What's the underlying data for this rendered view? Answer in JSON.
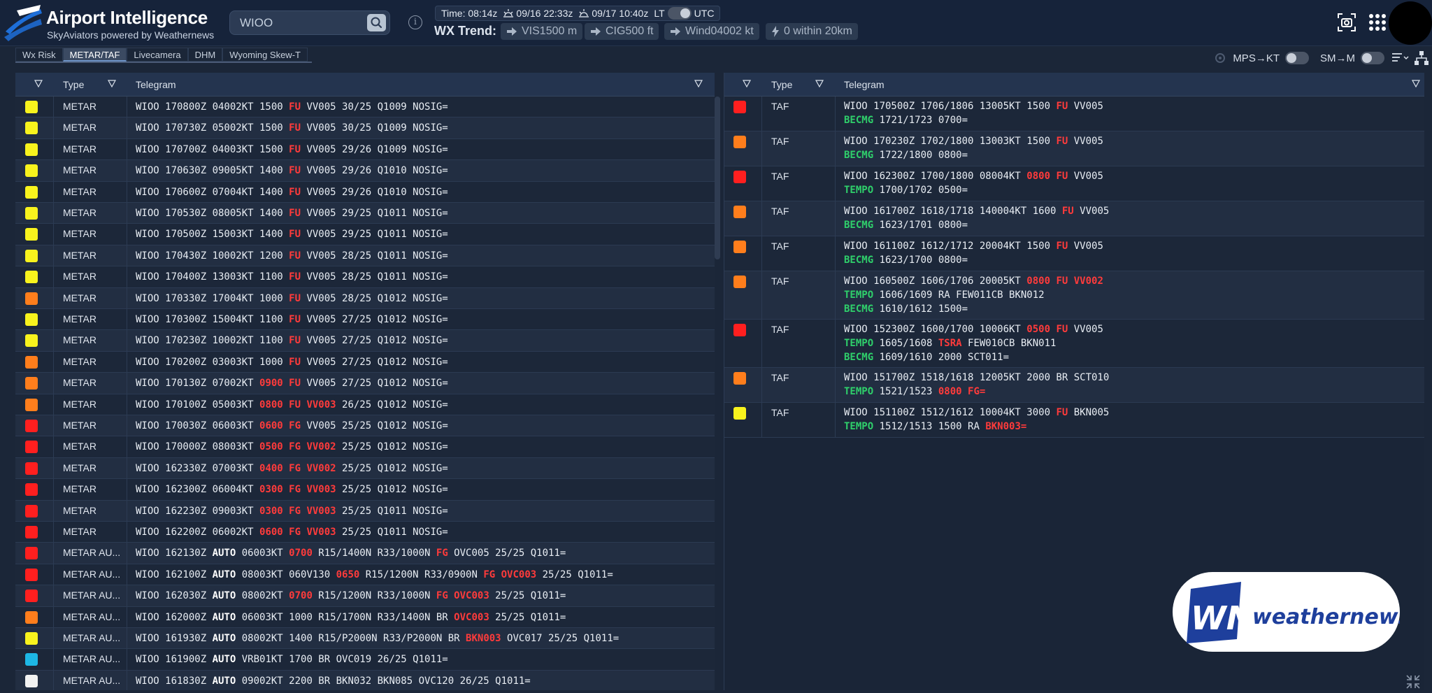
{
  "app": {
    "title": "Airport Intelligence",
    "subtitle": "SkyAviators powered by Weathernews",
    "brand_color": "#1e6fd9"
  },
  "search": {
    "value": "WIOO",
    "placeholder": "WIOO"
  },
  "timebar": {
    "time": "Time: 08:14z",
    "sunrise": "09/16 22:33z",
    "sunset": "09/17 10:40z",
    "lt_label": "LT",
    "utc_label": "UTC"
  },
  "wx_trend": {
    "label": "WX Trend:",
    "chips": [
      {
        "icon": "arrow-right-icon",
        "text": "VIS1500 m"
      },
      {
        "icon": "arrow-right-icon",
        "text": "CIG500 ft"
      },
      {
        "icon": "arrow-right-icon",
        "text": "Wind04002 kt"
      },
      {
        "icon": "lightning-icon",
        "text": "0 within 20km"
      }
    ]
  },
  "tabs": [
    "Wx Risk",
    "METAR/TAF",
    "Livecamera",
    "DHM",
    "Wyoming Skew-T"
  ],
  "active_tab": "METAR/TAF",
  "toggles": {
    "mps_kt": "MPS→KT",
    "sm_m": "SM→M"
  },
  "columns": {
    "type": "Type",
    "telegram": "Telegram"
  },
  "status_colors": {
    "yellow": "#f8f31d",
    "orange": "#ff7e1c",
    "red": "#ff1f1f",
    "cyan": "#1db7e5",
    "white": "#f2f2f2"
  },
  "metar_rows": [
    {
      "color": "yellow",
      "type": "METAR",
      "parts": [
        [
          "WIOO 170800Z 04002KT 1500 ",
          ""
        ],
        [
          "FU",
          "red"
        ],
        [
          " VV005 30/25 Q1009 NOSIG=",
          ""
        ]
      ]
    },
    {
      "color": "yellow",
      "type": "METAR",
      "parts": [
        [
          "WIOO 170730Z 05002KT 1500 ",
          ""
        ],
        [
          "FU",
          "red"
        ],
        [
          " VV005 30/25 Q1009 NOSIG=",
          ""
        ]
      ]
    },
    {
      "color": "yellow",
      "type": "METAR",
      "parts": [
        [
          "WIOO 170700Z 04003KT 1500 ",
          ""
        ],
        [
          "FU",
          "red"
        ],
        [
          " VV005 29/26 Q1009 NOSIG=",
          ""
        ]
      ]
    },
    {
      "color": "yellow",
      "type": "METAR",
      "parts": [
        [
          "WIOO 170630Z 09005KT 1400 ",
          ""
        ],
        [
          "FU",
          "red"
        ],
        [
          " VV005 29/26 Q1010 NOSIG=",
          ""
        ]
      ]
    },
    {
      "color": "yellow",
      "type": "METAR",
      "parts": [
        [
          "WIOO 170600Z 07004KT 1400 ",
          ""
        ],
        [
          "FU",
          "red"
        ],
        [
          " VV005 29/26 Q1010 NOSIG=",
          ""
        ]
      ]
    },
    {
      "color": "yellow",
      "type": "METAR",
      "parts": [
        [
          "WIOO 170530Z 08005KT 1400 ",
          ""
        ],
        [
          "FU",
          "red"
        ],
        [
          " VV005 29/25 Q1011 NOSIG=",
          ""
        ]
      ]
    },
    {
      "color": "yellow",
      "type": "METAR",
      "parts": [
        [
          "WIOO 170500Z 15003KT 1400 ",
          ""
        ],
        [
          "FU",
          "red"
        ],
        [
          " VV005 29/25 Q1011 NOSIG=",
          ""
        ]
      ]
    },
    {
      "color": "yellow",
      "type": "METAR",
      "parts": [
        [
          "WIOO 170430Z 10002KT 1200 ",
          ""
        ],
        [
          "FU",
          "red"
        ],
        [
          " VV005 28/25 Q1011 NOSIG=",
          ""
        ]
      ]
    },
    {
      "color": "yellow",
      "type": "METAR",
      "parts": [
        [
          "WIOO 170400Z 13003KT 1100 ",
          ""
        ],
        [
          "FU",
          "red"
        ],
        [
          " VV005 28/25 Q1011 NOSIG=",
          ""
        ]
      ]
    },
    {
      "color": "orange",
      "type": "METAR",
      "parts": [
        [
          "WIOO 170330Z 17004KT 1000 ",
          ""
        ],
        [
          "FU",
          "red"
        ],
        [
          " VV005 28/25 Q1012 NOSIG=",
          ""
        ]
      ]
    },
    {
      "color": "yellow",
      "type": "METAR",
      "parts": [
        [
          "WIOO 170300Z 15004KT 1100 ",
          ""
        ],
        [
          "FU",
          "red"
        ],
        [
          " VV005 27/25 Q1012 NOSIG=",
          ""
        ]
      ]
    },
    {
      "color": "yellow",
      "type": "METAR",
      "parts": [
        [
          "WIOO 170230Z 10002KT 1100 ",
          ""
        ],
        [
          "FU",
          "red"
        ],
        [
          " VV005 27/25 Q1012 NOSIG=",
          ""
        ]
      ]
    },
    {
      "color": "orange",
      "type": "METAR",
      "parts": [
        [
          "WIOO 170200Z 03003KT 1000 ",
          ""
        ],
        [
          "FU",
          "red"
        ],
        [
          " VV005 27/25 Q1012 NOSIG=",
          ""
        ]
      ]
    },
    {
      "color": "orange",
      "type": "METAR",
      "parts": [
        [
          "WIOO 170130Z 07002KT ",
          ""
        ],
        [
          "0900 FU",
          "red"
        ],
        [
          " VV005 27/25 Q1012 NOSIG=",
          ""
        ]
      ]
    },
    {
      "color": "orange",
      "type": "METAR",
      "parts": [
        [
          "WIOO 170100Z 05003KT ",
          ""
        ],
        [
          "0800 FU VV003",
          "red"
        ],
        [
          " 26/25 Q1012 NOSIG=",
          ""
        ]
      ]
    },
    {
      "color": "red",
      "type": "METAR",
      "parts": [
        [
          "WIOO 170030Z 06003KT ",
          ""
        ],
        [
          "0600 FG",
          "red"
        ],
        [
          " VV005 25/25 Q1012 NOSIG=",
          ""
        ]
      ]
    },
    {
      "color": "red",
      "type": "METAR",
      "parts": [
        [
          "WIOO 170000Z 08003KT ",
          ""
        ],
        [
          "0500 FG VV002",
          "red"
        ],
        [
          " 25/25 Q1012 NOSIG=",
          ""
        ]
      ]
    },
    {
      "color": "red",
      "type": "METAR",
      "parts": [
        [
          "WIOO 162330Z 07003KT ",
          ""
        ],
        [
          "0400 FG VV002",
          "red"
        ],
        [
          " 25/25 Q1012 NOSIG=",
          ""
        ]
      ]
    },
    {
      "color": "red",
      "type": "METAR",
      "parts": [
        [
          "WIOO 162300Z 06004KT ",
          ""
        ],
        [
          "0300 FG VV003",
          "red"
        ],
        [
          " 25/25 Q1012 NOSIG=",
          ""
        ]
      ]
    },
    {
      "color": "red",
      "type": "METAR",
      "parts": [
        [
          "WIOO 162230Z 09003KT ",
          ""
        ],
        [
          "0300 FG VV003",
          "red"
        ],
        [
          " 25/25 Q1011 NOSIG=",
          ""
        ]
      ]
    },
    {
      "color": "red",
      "type": "METAR",
      "parts": [
        [
          "WIOO 162200Z 06002KT ",
          ""
        ],
        [
          "0600 FG VV003",
          "red"
        ],
        [
          " 25/25 Q1011 NOSIG=",
          ""
        ]
      ]
    },
    {
      "color": "red",
      "type": "METAR AU...",
      "parts": [
        [
          "WIOO 162130Z ",
          ""
        ],
        [
          "AUTO",
          "bold"
        ],
        [
          " 06003KT ",
          ""
        ],
        [
          "0700",
          "red"
        ],
        [
          " R15/1400N R33/1000N ",
          ""
        ],
        [
          "FG",
          "red"
        ],
        [
          " OVC005 25/25 Q1011=",
          ""
        ]
      ]
    },
    {
      "color": "red",
      "type": "METAR AU...",
      "parts": [
        [
          "WIOO 162100Z ",
          ""
        ],
        [
          "AUTO",
          "bold"
        ],
        [
          " 08003KT 060V130 ",
          ""
        ],
        [
          "0650",
          "red"
        ],
        [
          " R15/1200N R33/0900N ",
          ""
        ],
        [
          "FG OVC003",
          "red"
        ],
        [
          " 25/25 Q1011=",
          ""
        ]
      ]
    },
    {
      "color": "red",
      "type": "METAR AU...",
      "parts": [
        [
          "WIOO 162030Z ",
          ""
        ],
        [
          "AUTO",
          "bold"
        ],
        [
          " 08002KT ",
          ""
        ],
        [
          "0700",
          "red"
        ],
        [
          " R15/1200N R33/1000N ",
          ""
        ],
        [
          "FG OVC003",
          "red"
        ],
        [
          " 25/25 Q1011=",
          ""
        ]
      ]
    },
    {
      "color": "orange",
      "type": "METAR AU...",
      "parts": [
        [
          "WIOO 162000Z ",
          ""
        ],
        [
          "AUTO",
          "bold"
        ],
        [
          " 06003KT 1000 R15/1700N R33/1400N BR ",
          ""
        ],
        [
          "OVC003",
          "red"
        ],
        [
          " 25/25 Q1011=",
          ""
        ]
      ]
    },
    {
      "color": "yellow",
      "type": "METAR AU...",
      "parts": [
        [
          "WIOO 161930Z ",
          ""
        ],
        [
          "AUTO",
          "bold"
        ],
        [
          " 08002KT 1400 R15/P2000N R33/P2000N BR ",
          ""
        ],
        [
          "BKN003",
          "red"
        ],
        [
          " OVC017 25/25 Q1011=",
          ""
        ]
      ]
    },
    {
      "color": "cyan",
      "type": "METAR AU...",
      "parts": [
        [
          "WIOO 161900Z ",
          ""
        ],
        [
          "AUTO",
          "bold"
        ],
        [
          " VRB01KT 1700 BR OVC019 26/25 Q1011=",
          ""
        ]
      ]
    },
    {
      "color": "white",
      "type": "METAR AU...",
      "parts": [
        [
          "WIOO 161830Z ",
          ""
        ],
        [
          "AUTO",
          "bold"
        ],
        [
          " 09002KT 2200 BR BKN032 BKN085 OVC120 26/25 Q1011=",
          ""
        ]
      ]
    }
  ],
  "taf_rows": [
    {
      "color": "red",
      "type": "TAF",
      "lines": [
        [
          [
            "WIOO 170500Z 1706/1806 13005KT 1500 ",
            ""
          ],
          [
            "FU",
            "red"
          ],
          [
            " VV005",
            ""
          ]
        ],
        [
          [
            "BECMG",
            "green"
          ],
          [
            " 1721/1723 0700=",
            ""
          ]
        ]
      ]
    },
    {
      "color": "orange",
      "type": "TAF",
      "lines": [
        [
          [
            "WIOO 170230Z 1702/1800 13003KT 1500 ",
            ""
          ],
          [
            "FU",
            "red"
          ],
          [
            " VV005",
            ""
          ]
        ],
        [
          [
            "BECMG",
            "green"
          ],
          [
            " 1722/1800 0800=",
            ""
          ]
        ]
      ]
    },
    {
      "color": "red",
      "type": "TAF",
      "lines": [
        [
          [
            "WIOO 162300Z 1700/1800 08004KT ",
            ""
          ],
          [
            "0800 FU",
            "red"
          ],
          [
            " VV005",
            ""
          ]
        ],
        [
          [
            "TEMPO",
            "green"
          ],
          [
            " 1700/1702 0500=",
            ""
          ]
        ]
      ]
    },
    {
      "color": "orange",
      "type": "TAF",
      "lines": [
        [
          [
            "WIOO 161700Z 1618/1718 140004KT 1600 ",
            ""
          ],
          [
            "FU",
            "red"
          ],
          [
            " VV005",
            ""
          ]
        ],
        [
          [
            "BECMG",
            "green"
          ],
          [
            " 1623/1701 0800=",
            ""
          ]
        ]
      ]
    },
    {
      "color": "orange",
      "type": "TAF",
      "lines": [
        [
          [
            "WIOO 161100Z 1612/1712 20004KT 1500 ",
            ""
          ],
          [
            "FU",
            "red"
          ],
          [
            " VV005",
            ""
          ]
        ],
        [
          [
            "BECMG",
            "green"
          ],
          [
            " 1623/1700 0800=",
            ""
          ]
        ]
      ]
    },
    {
      "color": "orange",
      "type": "TAF",
      "lines": [
        [
          [
            "WIOO 160500Z 1606/1706 20005KT ",
            ""
          ],
          [
            "0800 FU VV002",
            "red"
          ]
        ],
        [
          [
            "TEMPO",
            "green"
          ],
          [
            " 1606/1609 RA FEW011CB BKN012",
            ""
          ]
        ],
        [
          [
            "BECMG",
            "green"
          ],
          [
            " 1610/1612 1500=",
            ""
          ]
        ]
      ]
    },
    {
      "color": "red",
      "type": "TAF",
      "lines": [
        [
          [
            "WIOO 152300Z 1600/1700 10006KT ",
            ""
          ],
          [
            "0500 FU",
            "red"
          ],
          [
            " VV005",
            ""
          ]
        ],
        [
          [
            "TEMPO",
            "green"
          ],
          [
            " 1605/1608 ",
            ""
          ],
          [
            "TSRA",
            "red"
          ],
          [
            " FEW010CB BKN011",
            ""
          ]
        ],
        [
          [
            "BECMG",
            "green"
          ],
          [
            " 1609/1610 2000 SCT011=",
            ""
          ]
        ]
      ]
    },
    {
      "color": "orange",
      "type": "TAF",
      "lines": [
        [
          [
            "WIOO 151700Z 1518/1618 12005KT 2000 BR SCT010",
            ""
          ]
        ],
        [
          [
            "TEMPO",
            "green"
          ],
          [
            " 1521/1523 ",
            ""
          ],
          [
            "0800 FG=",
            "red"
          ]
        ]
      ]
    },
    {
      "color": "yellow",
      "type": "TAF",
      "lines": [
        [
          [
            "WIOO 151100Z 1512/1612 10004KT 3000 ",
            ""
          ],
          [
            "FU",
            "red"
          ],
          [
            " BKN005",
            ""
          ]
        ],
        [
          [
            "TEMPO",
            "green"
          ],
          [
            " 1512/1513 1500 RA ",
            ""
          ],
          [
            "BKN003=",
            "red"
          ]
        ]
      ]
    }
  ],
  "watermark": {
    "brand_text": "weathernews",
    "logo_text": "WN"
  }
}
